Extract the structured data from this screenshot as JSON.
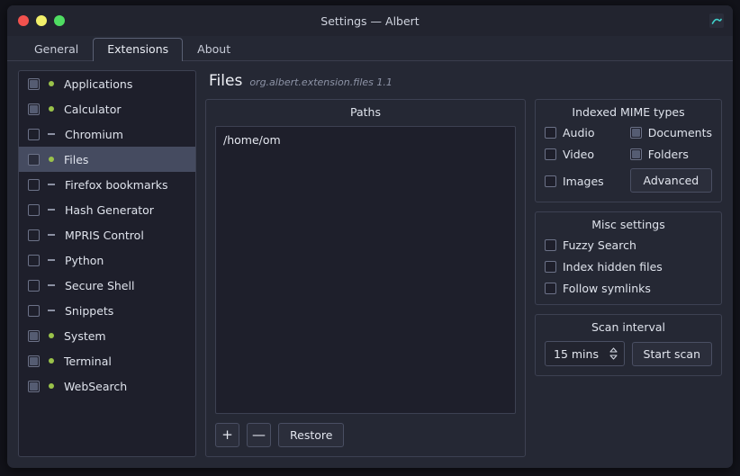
{
  "window": {
    "title": "Settings — Albert",
    "app_icon": "albert-icon",
    "controls": [
      "close",
      "minimize",
      "maximize"
    ]
  },
  "tabs": [
    {
      "label": "General",
      "selected": false
    },
    {
      "label": "Extensions",
      "selected": true
    },
    {
      "label": "About",
      "selected": false
    }
  ],
  "sidebar": {
    "items": [
      {
        "label": "Applications",
        "checked": true,
        "status": "dot"
      },
      {
        "label": "Calculator",
        "checked": true,
        "status": "dot"
      },
      {
        "label": "Chromium",
        "checked": false,
        "status": "dash"
      },
      {
        "label": "Files",
        "checked": false,
        "status": "dot",
        "selected": true
      },
      {
        "label": "Firefox bookmarks",
        "checked": false,
        "status": "dash"
      },
      {
        "label": "Hash Generator",
        "checked": false,
        "status": "dash"
      },
      {
        "label": "MPRIS Control",
        "checked": false,
        "status": "dash"
      },
      {
        "label": "Python",
        "checked": false,
        "status": "dash"
      },
      {
        "label": "Secure Shell",
        "checked": false,
        "status": "dash"
      },
      {
        "label": "Snippets",
        "checked": false,
        "status": "dash"
      },
      {
        "label": "System",
        "checked": true,
        "status": "dot"
      },
      {
        "label": "Terminal",
        "checked": true,
        "status": "dot"
      },
      {
        "label": "WebSearch",
        "checked": true,
        "status": "dot"
      }
    ]
  },
  "extension": {
    "title": "Files",
    "id": "org.albert.extension.files 1.1"
  },
  "paths": {
    "group_title": "Paths",
    "items": [
      "/home/om"
    ],
    "add_label": "+",
    "remove_label": "—",
    "restore_label": "Restore"
  },
  "mime": {
    "group_title": "Indexed MIME types",
    "options": [
      {
        "label": "Audio",
        "checked": false
      },
      {
        "label": "Documents",
        "checked": true
      },
      {
        "label": "Video",
        "checked": false
      },
      {
        "label": "Folders",
        "checked": true
      },
      {
        "label": "Images",
        "checked": false
      }
    ],
    "advanced_label": "Advanced"
  },
  "misc": {
    "group_title": "Misc settings",
    "options": [
      {
        "label": "Fuzzy Search",
        "checked": false
      },
      {
        "label": "Index hidden files",
        "checked": false
      },
      {
        "label": "Follow symlinks",
        "checked": false
      }
    ]
  },
  "scan": {
    "group_title": "Scan interval",
    "interval_value": "15 mins",
    "start_label": "Start scan"
  },
  "colors": {
    "window_bg": "#252834",
    "panel_bg": "#1e1f2b",
    "border": "#3d4152",
    "selection": "#454b60",
    "enabled_dot": "#9ac24a",
    "text": "#dfe3ec",
    "close": "#f2524e",
    "minimize": "#f2f06a",
    "maximize": "#4fdd62"
  }
}
